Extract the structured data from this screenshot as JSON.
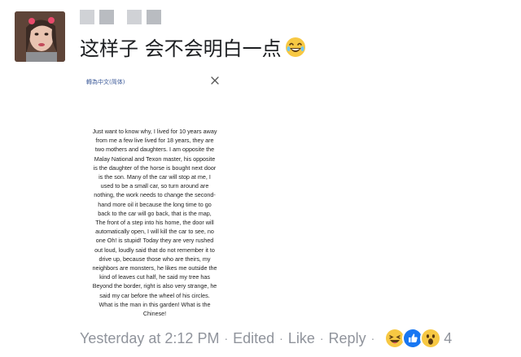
{
  "comment": {
    "message": "这样子 会不会明白一点",
    "message_emoji": "laughing-emoji",
    "shared_image": {
      "header": "轉為中文(简体)",
      "text": "Just want to know why, I lived for 10 years away\nfrom me a few live lived for 18 years, they are\ntwo mothers and daughters. I am opposite the\nMalay National and Texon master, his opposite\nis the daughter of the horse is bought next door\nis the son. Many of the car will stop at me, I\nused to be a small car, so turn around are\nnothing, the work needs to change the second-\nhand more oil it because the long time to go\nback to the car will go back, that is the map,\nThe front of a step into his home, the door will\nautomatically open, I will kill the car to see, no\none Oh! is stupid! Today they are very rushed\nout loud, loudly said that do not remember it to\ndrive up, because those who are theirs, my\nneighbors are monsters, he likes me outside the\nkind of leaves cut half, he said my tree has\nBeyond the border, right is also very strange, he\nsaid my car before the wheel of his circles.\nWhat is the man in this garden! What is the\nChinese!"
    },
    "footer": {
      "timestamp": "Yesterday at 2:12 PM",
      "separator": "·",
      "edited": "Edited",
      "like": "Like",
      "reply": "Reply",
      "reaction_count": "4",
      "reactions": [
        "haha-reaction",
        "like-reaction",
        "wow-reaction"
      ]
    },
    "colors": {
      "text": "#1c1e21",
      "meta": "#90949c",
      "like_blue": "#1877f2",
      "emoji_yellow": "#f7c843"
    }
  }
}
